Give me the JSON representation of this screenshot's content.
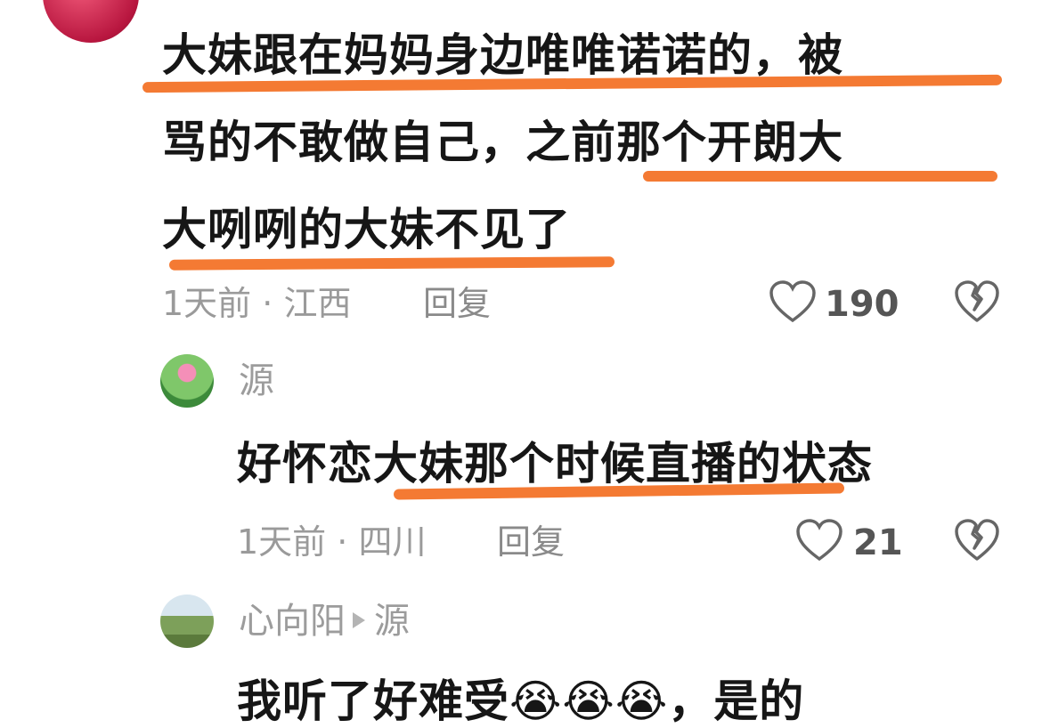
{
  "comment1": {
    "lines": [
      "大妹跟在妈妈身边唯唯诺诺的，被",
      "骂的不敢做自己，之前那个开朗大",
      "大咧咧的大妹不见了"
    ],
    "time": "1天前",
    "separator": "·",
    "location": "江西",
    "reply_label": "回复",
    "likes": "190"
  },
  "reply1": {
    "username": "源",
    "text": "好怀恋大妹那个时候直播的状态",
    "time": "1天前",
    "separator": "·",
    "location": "四川",
    "reply_label": "回复",
    "likes": "21"
  },
  "reply2": {
    "username": "心向阳",
    "reply_to": "源",
    "text_partial": "我听了好难受😭😭😭，是的"
  },
  "colors": {
    "underline": "#f47a33",
    "meta": "#9a9a9a"
  }
}
